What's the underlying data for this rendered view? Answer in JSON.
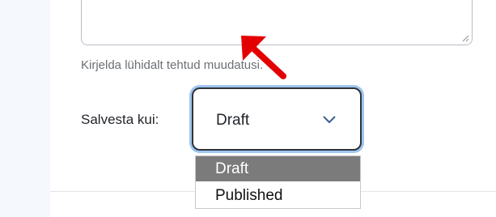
{
  "form": {
    "help_text": "Kirjelda lühidalt tehtud muudatusi.",
    "save_as_label": "Salvesta kui:",
    "status_select": {
      "selected_value": "Draft",
      "options": [
        "Draft",
        "Published"
      ],
      "highlighted_option": "Draft"
    }
  },
  "icons": {
    "select_chevron": "chevron-down-icon",
    "resize_handle": "resize-handle-icon",
    "pointer_arrow": "red-arrow-annotation"
  },
  "colors": {
    "focus_ring": "#9ec5f0",
    "annotation_arrow": "#e30000",
    "selected_option_bg": "#7b7b7b",
    "left_rail": "#f5f8fc"
  }
}
